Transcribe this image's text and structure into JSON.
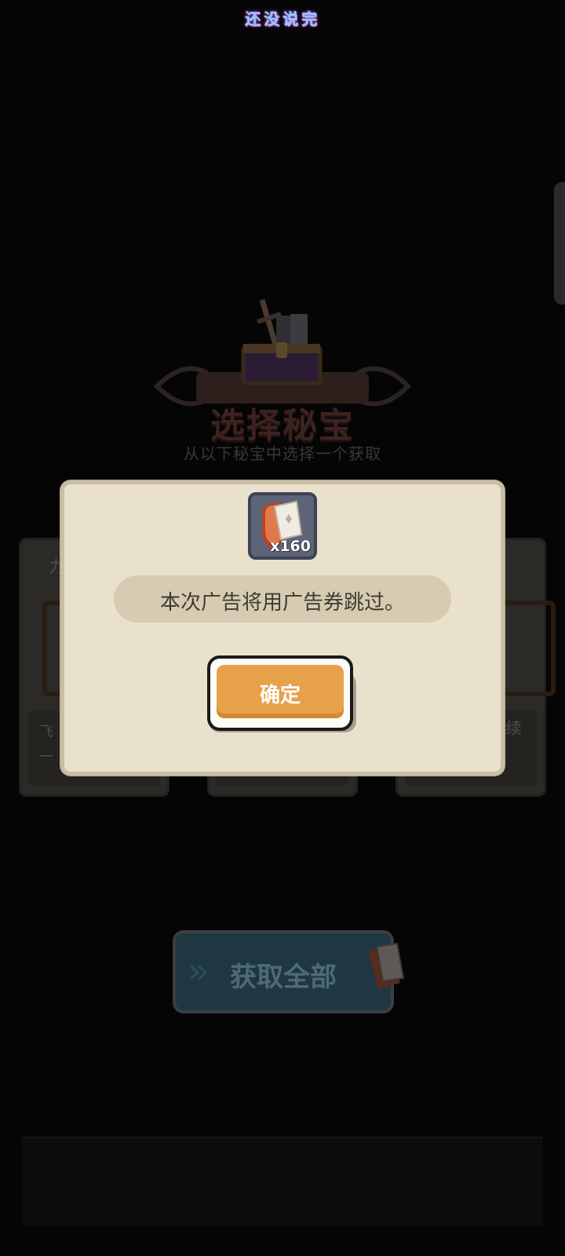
{
  "watermark": "还没说完",
  "scene": {
    "banner_title": "选择秘宝",
    "banner_subtitle": "从以下秘宝中选择一个获取",
    "card_left": {
      "title_fragment": "力",
      "desc_line1": "飞",
      "desc_line2": "一"
    },
    "card_right": {
      "desc_fragment": "续"
    },
    "get_all_label": "获取全部"
  },
  "dialog": {
    "ticket_count": "x160",
    "message": "本次广告将用广告券跳过。",
    "confirm_label": "确定"
  },
  "colors": {
    "dialog_bg": "#e9e1cb",
    "message_pill": "#d7ccb1",
    "confirm_orange": "#e7a14a",
    "overlay_dark": "#060505"
  },
  "icons": [
    "treasure-chest-icon",
    "ad-ticket-icon",
    "chevron-right-icon"
  ]
}
